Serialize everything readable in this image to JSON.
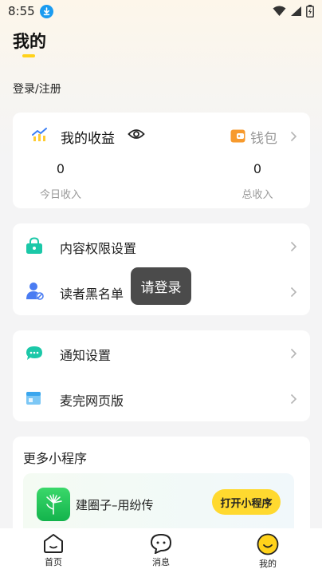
{
  "status_bar": {
    "time": "8:55",
    "icons": [
      "download-badge-icon",
      "wifi-icon",
      "signal-icon",
      "battery-icon"
    ]
  },
  "header": {
    "title": "我的"
  },
  "login": {
    "label": "登录/注册"
  },
  "earnings": {
    "title": "我的收益",
    "wallet_label": "钱包",
    "today_value": "0",
    "today_label": "今日收入",
    "total_value": "0",
    "total_label": "总收入",
    "icons": [
      "chart-trend-icon",
      "eye-icon",
      "wallet-icon",
      "chevron-right-icon"
    ]
  },
  "menu_group_1": [
    {
      "label": "内容权限设置",
      "icon": "lock-icon"
    },
    {
      "label": "读者黑名单",
      "icon": "blocked-user-icon"
    }
  ],
  "menu_group_2": [
    {
      "label": "通知设置",
      "icon": "chat-bubble-icon"
    },
    {
      "label": "麦完网页版",
      "icon": "browser-window-icon"
    }
  ],
  "toast": {
    "text": "请登录"
  },
  "mini_programs": {
    "title": "更多小程序",
    "items": [
      {
        "name": "建圈子–用纷传",
        "button": "打开小程序",
        "icon": "dandelion-icon"
      }
    ]
  },
  "tab_bar": {
    "tabs": [
      {
        "label": "首页",
        "icon": "home-icon"
      },
      {
        "label": "消息",
        "icon": "message-icon"
      },
      {
        "label": "我的",
        "icon": "smiley-icon"
      }
    ],
    "active_index": 2
  },
  "colors": {
    "accent_yellow": "#ffd21a",
    "toast_bg": "#4b4b4b",
    "mini_button": "#ffd92f"
  }
}
